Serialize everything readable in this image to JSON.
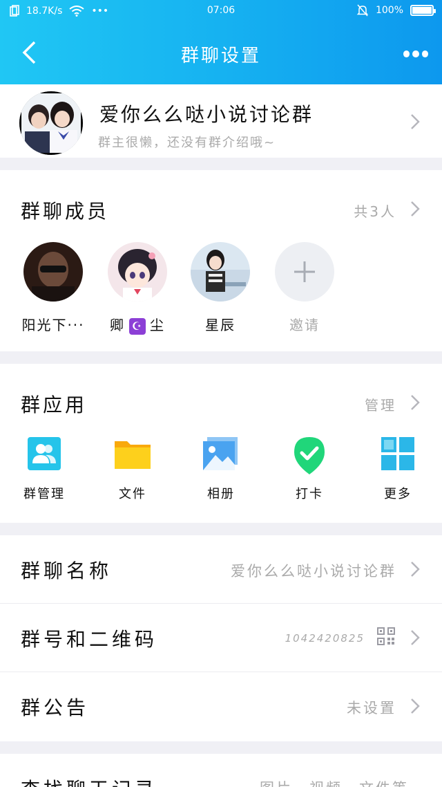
{
  "status_bar": {
    "speed": "18.7K/s",
    "dots": "•••",
    "time": "07:06",
    "battery": "100%"
  },
  "header": {
    "title": "群聊设置"
  },
  "group": {
    "name": "爱你么么哒小说讨论群",
    "intro": "群主很懒，还没有群介绍哦~"
  },
  "members": {
    "title": "群聊成员",
    "count": "共3人",
    "items": [
      {
        "name": "阳光下···"
      },
      {
        "name_left": "卿",
        "name_right": "尘"
      },
      {
        "name": "星辰"
      }
    ],
    "invite_label": "邀请"
  },
  "apps": {
    "title": "群应用",
    "manage": "管理",
    "items": [
      {
        "label": "群管理",
        "icon": "group-manage-icon"
      },
      {
        "label": "文件",
        "icon": "folder-icon"
      },
      {
        "label": "相册",
        "icon": "album-icon"
      },
      {
        "label": "打卡",
        "icon": "checkin-icon"
      },
      {
        "label": "更多",
        "icon": "more-apps-icon"
      }
    ]
  },
  "settings": {
    "name_label": "群聊名称",
    "name_value": "爱你么么哒小说讨论群",
    "number_label": "群号和二维码",
    "number_value": "1042420825",
    "notice_label": "群公告",
    "notice_value": "未设置"
  },
  "history": {
    "label": "查找聊天记录",
    "value": "图片、视频、文件等"
  },
  "colors": {
    "header_start": "#20c7f4",
    "header_end": "#0d98ee",
    "secondary_text": "#aaaaaa"
  }
}
